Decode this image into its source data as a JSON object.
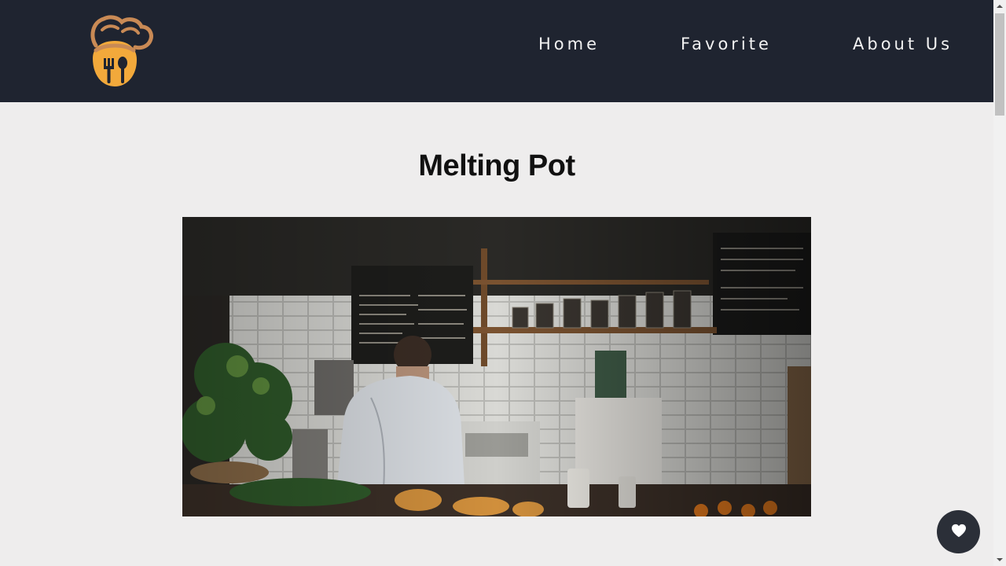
{
  "nav": {
    "links": [
      "Home",
      "Favorite",
      "About Us"
    ]
  },
  "main": {
    "title": "Melting Pot"
  },
  "colors": {
    "navbar_bg": "#1f2430",
    "page_bg": "#eeeded",
    "logo_orange": "#f2a93b",
    "logo_tan": "#c98a55",
    "fab_bg": "#2b2f38"
  },
  "icons": {
    "logo": "chef-hat-fork-spoon-logo",
    "fab": "heart-icon"
  }
}
